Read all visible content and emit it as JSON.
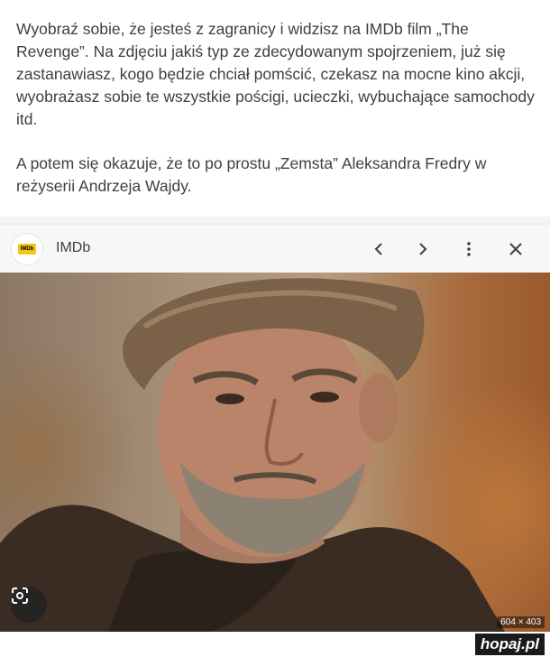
{
  "post": {
    "paragraph1": "Wyobraź sobie, że jesteś z zagranicy i widzisz na IMDb film „The Revenge”. Na zdjęciu jakiś typ ze zdecydowanym spojrzeniem, już się zastanawiasz, kogo będzie chciał pomścić, czekasz na mocne kino akcji, wyobrażasz sobie te wszystkie pościgi, ucieczki, wybuchające samochody itd.",
    "paragraph2": "A potem się okazuje, że to po prostu „Zemsta” Aleksandra Fredry w reżyserii Andrzeja Wajdy."
  },
  "viewer": {
    "site_name": "IMDb",
    "favicon_text": "IMDb",
    "icons": [
      "chevron-left-icon",
      "chevron-right-icon",
      "more-vert-icon",
      "close-icon"
    ]
  },
  "image": {
    "dimensions": "604 × 403",
    "lens_icon": "google-lens-icon"
  },
  "watermark": "hopaj.pl"
}
